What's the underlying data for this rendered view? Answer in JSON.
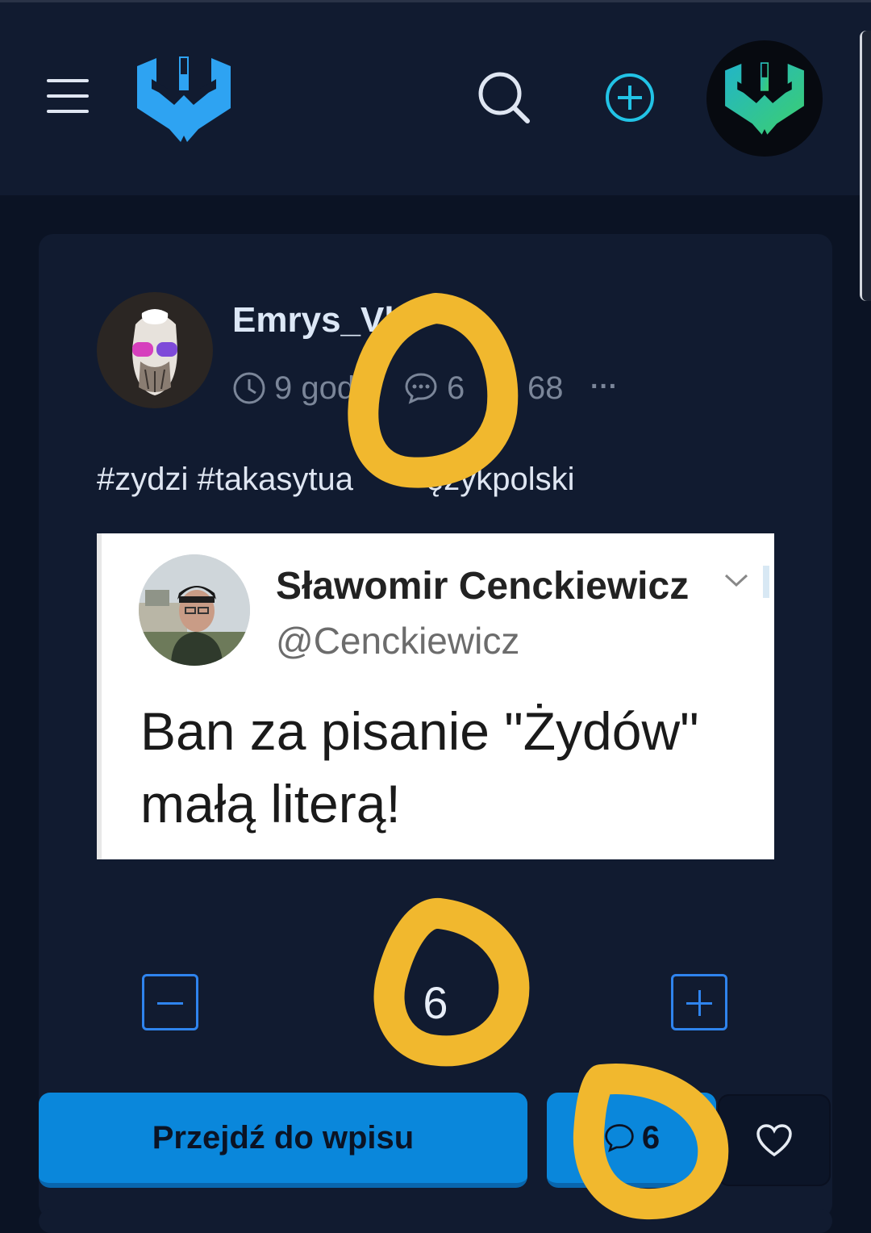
{
  "header": {
    "menu_icon": "hamburger-icon",
    "logo_icon": "site-logo",
    "search_icon": "search-icon",
    "add_icon": "plus-circle-icon",
    "profile_icon": "user-avatar"
  },
  "post": {
    "author": "Emrys_Vle",
    "time": "9 god",
    "comments_count": "6",
    "votes_count": "68",
    "more_label": "···",
    "tags": "#zydzi #takasytua",
    "tags_tail": "ęzykpolski",
    "embed": {
      "name": "Sławomir Cenckiewicz",
      "handle": "@Cenckiewicz",
      "text_line1": "Ban za pisanie \"Żydów\"",
      "text_line2": "małą literą!"
    },
    "score": "6",
    "go_label": "Przejdź do wpisu",
    "comments_button_count": "6"
  },
  "colors": {
    "background": "#0b1324",
    "card": "#111b30",
    "accent": "#0a87db",
    "brand_cyan": "#22c3e6",
    "annotation": "#f1b82e"
  }
}
